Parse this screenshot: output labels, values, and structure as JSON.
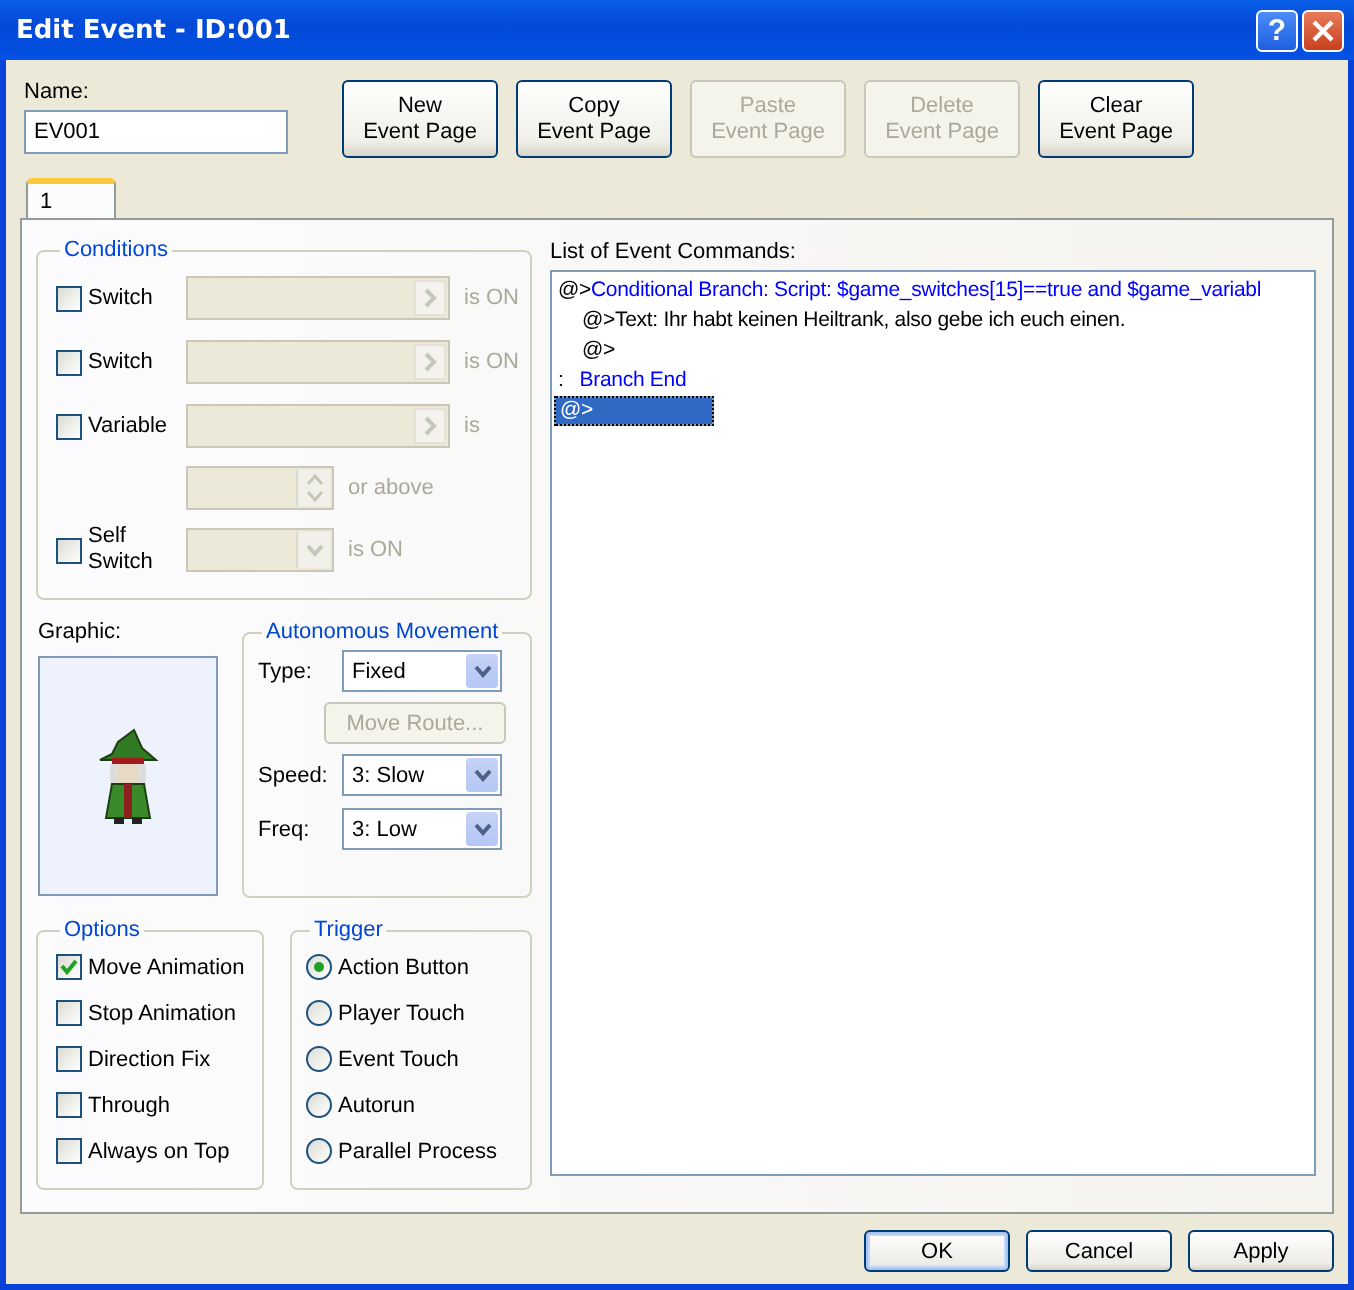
{
  "window": {
    "title": "Edit Event - ID:001",
    "help_glyph": "?"
  },
  "name": {
    "label": "Name:",
    "value": "EV001"
  },
  "page_buttons": [
    {
      "lines": [
        "New",
        "Event Page"
      ],
      "disabled": false
    },
    {
      "lines": [
        "Copy",
        "Event Page"
      ],
      "disabled": false
    },
    {
      "lines": [
        "Paste",
        "Event Page"
      ],
      "disabled": true
    },
    {
      "lines": [
        "Delete",
        "Event Page"
      ],
      "disabled": true
    },
    {
      "lines": [
        "Clear",
        "Event Page"
      ],
      "disabled": false
    }
  ],
  "tabs": [
    {
      "label": "1",
      "selected": true
    }
  ],
  "conditions": {
    "legend": "Conditions",
    "rows": [
      {
        "kind": "picker",
        "label": "Switch",
        "checked": false,
        "suffix": "is ON"
      },
      {
        "kind": "picker",
        "label": "Switch",
        "checked": false,
        "suffix": "is ON"
      },
      {
        "kind": "picker",
        "label": "Variable",
        "checked": false,
        "suffix": "is"
      },
      {
        "kind": "spin",
        "suffix": "or above"
      },
      {
        "kind": "combo",
        "label": "Self Switch",
        "checked": false,
        "suffix": "is ON"
      }
    ]
  },
  "graphic": {
    "label": "Graphic:"
  },
  "movement": {
    "legend": "Autonomous Movement",
    "rows": [
      {
        "kind": "select",
        "label": "Type:",
        "value": "Fixed"
      },
      {
        "kind": "button",
        "label": "Move Route...",
        "disabled": true
      },
      {
        "kind": "select",
        "label": "Speed:",
        "value": "3: Slow"
      },
      {
        "kind": "select",
        "label": "Freq:",
        "value": "3: Low"
      }
    ]
  },
  "options": {
    "legend": "Options",
    "items": [
      {
        "label": "Move Animation",
        "checked": true
      },
      {
        "label": "Stop Animation",
        "checked": false
      },
      {
        "label": "Direction Fix",
        "checked": false
      },
      {
        "label": "Through",
        "checked": false
      },
      {
        "label": "Always on Top",
        "checked": false
      }
    ]
  },
  "trigger": {
    "legend": "Trigger",
    "items": [
      {
        "label": "Action Button",
        "selected": true
      },
      {
        "label": "Player Touch",
        "selected": false
      },
      {
        "label": "Event Touch",
        "selected": false
      },
      {
        "label": "Autorun",
        "selected": false
      },
      {
        "label": "Parallel Process",
        "selected": false
      }
    ]
  },
  "commands": {
    "label": "List of Event Commands:",
    "lines": [
      {
        "prefix": "@>",
        "color": "#0000ff",
        "text": "Conditional Branch: Script: $game_switches[15]==true and $game_variabl",
        "selected": false,
        "children": [
          {
            "prefix": "@>",
            "color": "#000000",
            "text": "Text: Ihr habt keinen Heiltrank, also gebe ich euch einen.",
            "selected": false
          },
          {
            "prefix": "@>",
            "selected": false
          }
        ]
      },
      {
        "prefix": ":",
        "color": "#0000ff",
        "text": "Branch End",
        "selected": false
      },
      {
        "prefix": "@>",
        "selected": true
      }
    ]
  },
  "footer_buttons": [
    {
      "label": "OK",
      "default": true
    },
    {
      "label": "Cancel",
      "default": false
    },
    {
      "label": "Apply",
      "default": false
    }
  ]
}
